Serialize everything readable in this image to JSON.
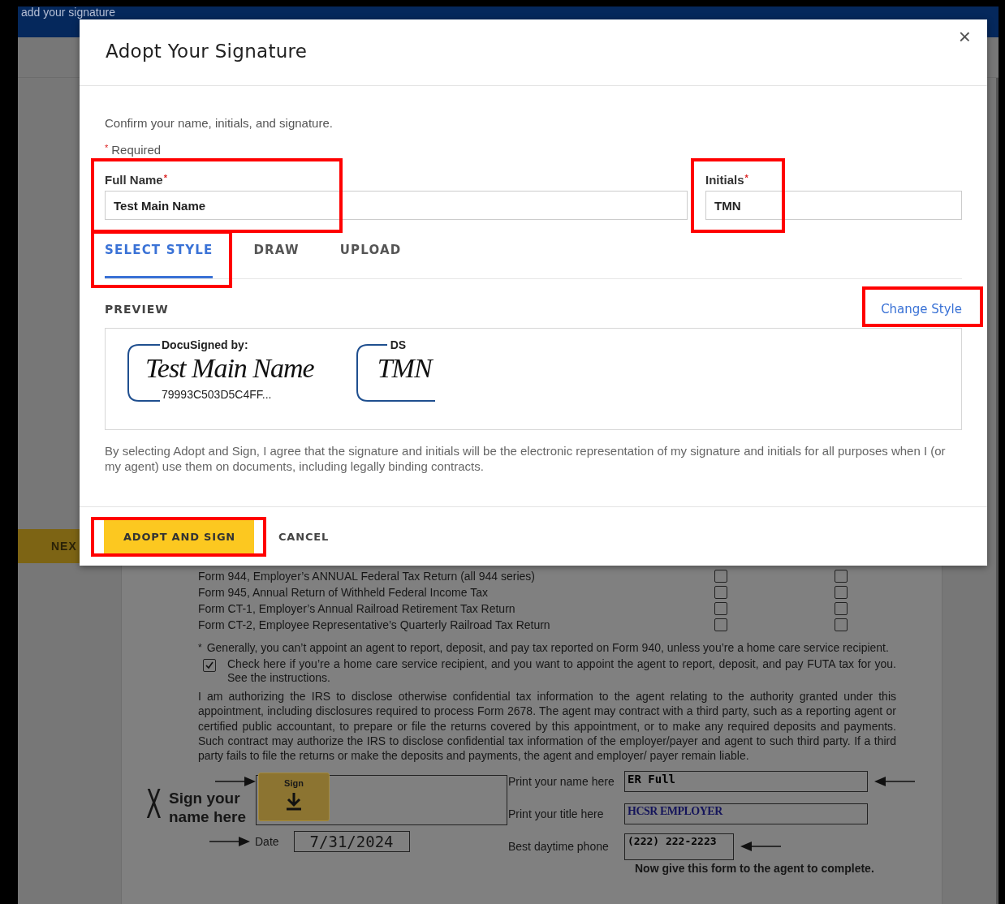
{
  "background_page": {
    "header_text": "add your signature",
    "next_button": "NEX",
    "form_rows": [
      {
        "label": "Form 944, Employer’s ANNUAL Federal Tax Return (all 944 series)",
        "checkboxes": [
          false,
          false
        ]
      },
      {
        "label": "Form 945, Annual Return of Withheld Federal Income Tax",
        "checkboxes": [
          false,
          false
        ]
      },
      {
        "label": "Form CT-1, Employer’s Annual Railroad Retirement Tax Return",
        "checkboxes": [
          false,
          false
        ]
      },
      {
        "label": "Form CT-2, Employee Representative’s Quarterly Railroad Tax Return",
        "checkboxes": [
          false,
          false
        ]
      }
    ],
    "footnote_mark": "*",
    "footnote": "Generally, you can’t appoint an agent to report, deposit, and pay tax reported on Form 940, unless you’re a home care service recipient.",
    "home_care": {
      "checked": true,
      "text": "Check here if you’re a home care service recipient, and you want to appoint the agent to report, deposit, and pay FUTA tax for you. See the instructions."
    },
    "authorization": "I am authorizing the IRS to disclose otherwise confidential tax information to the agent relating to the authority granted under this appointment, including disclosures required to process Form 2678. The agent may contract with a third party, such as a reporting agent or certified public accountant, to prepare or file the returns covered by this appointment, or to make any required deposits and payments. Such contract may authorize the IRS to disclose confidential tax information of the employer/payer and agent to such third party. If a third party fails to file the returns or make the deposits and  payments, the agent and employer/ payer remain liable.",
    "sign_area": {
      "x_mark": "X",
      "prompt": "Sign your name here",
      "sign_tag": "Sign",
      "date_label": "Date",
      "date": "7/31/2024",
      "fields": [
        {
          "label": "Print your name here",
          "value": "ER Full",
          "arrow": true,
          "kind": "wide"
        },
        {
          "label": "Print your title here",
          "value": "HCSR EMPLOYER",
          "arrow": false,
          "kind": "wide"
        },
        {
          "label": "Best daytime phone",
          "value": "(222) 222-2223",
          "arrow": true,
          "kind": "short"
        }
      ],
      "footer_note": "Now give this form to the agent to complete."
    }
  },
  "dialog": {
    "title": "Adopt Your Signature",
    "close": "×",
    "intro": "Confirm your name, initials, and signature.",
    "required_mark": "*",
    "required_note": "Required",
    "fields": [
      {
        "label": "Full Name",
        "mark": "*",
        "value": "Test Main Name",
        "highlighted": true,
        "kind": "name"
      },
      {
        "label": "Initials",
        "mark": "*",
        "value": "TMN",
        "highlighted": true,
        "kind": "initials"
      }
    ],
    "tabs": [
      {
        "label": "SELECT STYLE",
        "selected": true,
        "highlighted": true
      },
      {
        "label": "DRAW",
        "selected": false,
        "highlighted": false
      },
      {
        "label": "UPLOAD",
        "selected": false,
        "highlighted": false
      }
    ],
    "preview": {
      "heading": "PREVIEW",
      "change_style": {
        "label": "Change Style",
        "highlighted": true
      },
      "signature": {
        "caption": "DocuSigned by:",
        "text": "Test Main Name",
        "hash": "79993C503D5C4FF..."
      },
      "initials": {
        "caption": "DS",
        "text": "TMN"
      }
    },
    "agreement": "By selecting Adopt and Sign, I agree that the signature and initials will be the electronic representation of my signature and initials for all purposes when I (or my agent) use them on documents, including legally binding contracts.",
    "buttons": [
      {
        "label": "ADOPT AND SIGN",
        "kind": "primary",
        "highlighted": true
      },
      {
        "label": "CANCEL",
        "kind": "secondary",
        "highlighted": false
      }
    ]
  }
}
